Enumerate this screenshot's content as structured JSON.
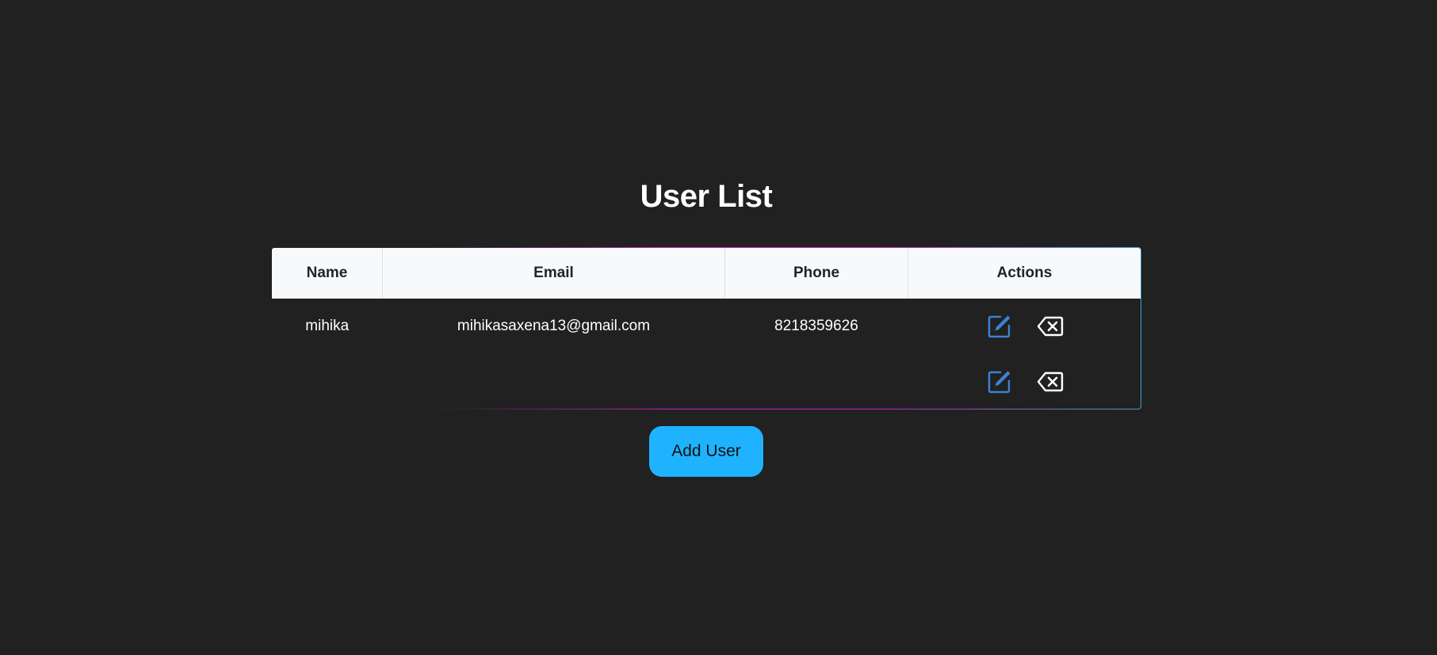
{
  "page": {
    "title": "User List"
  },
  "table": {
    "headers": {
      "name": "Name",
      "email": "Email",
      "phone": "Phone",
      "actions": "Actions"
    },
    "rows": [
      {
        "name": "mihika",
        "email": "mihikasaxena13@gmail.com",
        "phone": "8218359626"
      },
      {
        "name": "",
        "email": "",
        "phone": ""
      }
    ]
  },
  "icons": {
    "edit": "edit-icon",
    "delete": "backspace-delete-icon"
  },
  "actions": {
    "add_user_label": "Add User"
  },
  "colors": {
    "background": "#212121",
    "header_bg": "#f8f9fa",
    "edit_icon": "#3b82d6",
    "add_button": "#1fb3ff",
    "border_accent": "#c01ec8"
  }
}
